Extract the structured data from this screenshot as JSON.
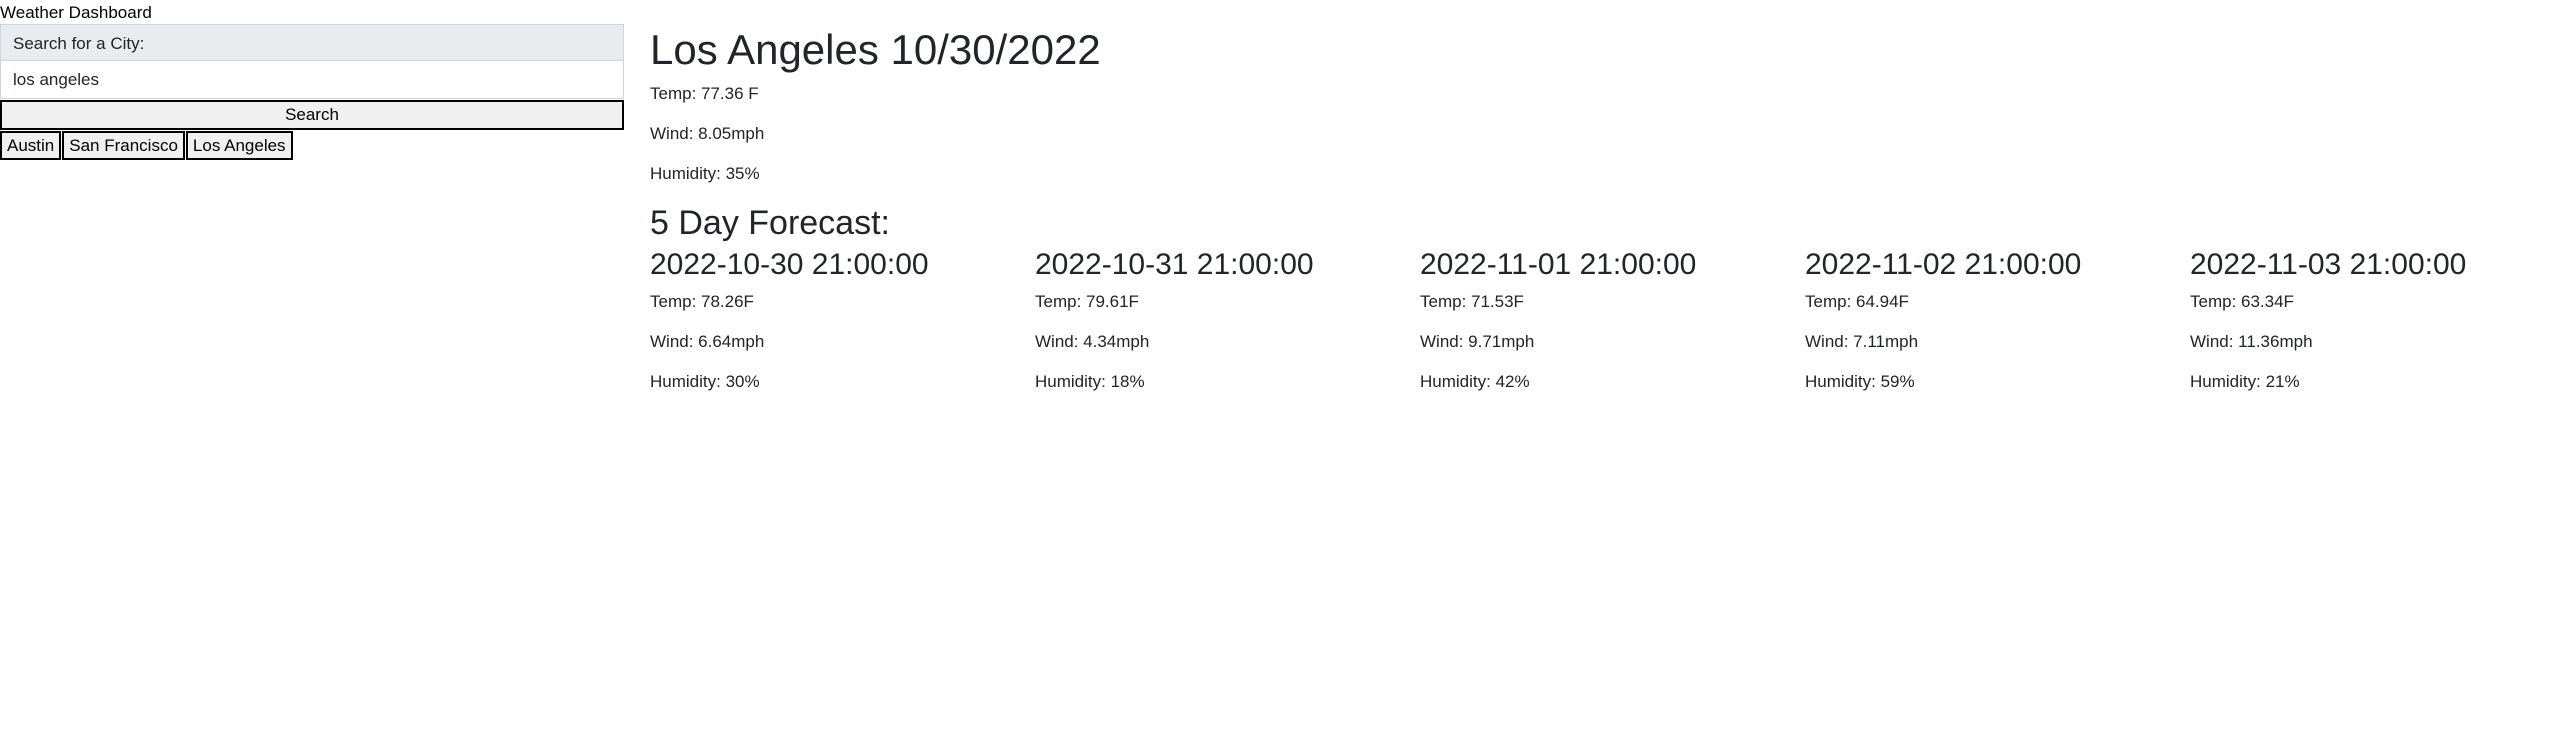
{
  "app": {
    "title": "Weather Dashboard"
  },
  "search": {
    "label": "Search for a City:",
    "value": "los angeles",
    "button_label": "Search"
  },
  "history": [
    "Austin",
    "San Francisco",
    "Los Angeles"
  ],
  "current": {
    "title": "Los Angeles 10/30/2022",
    "temp": "Temp: 77.36 F",
    "wind": "Wind: 8.05mph",
    "humidity": "Humidity: 35%"
  },
  "forecast": {
    "heading": "5 Day Forecast:",
    "days": [
      {
        "date": "2022-10-30 21:00:00",
        "temp": "Temp: 78.26F",
        "wind": "Wind: 6.64mph",
        "humidity": "Humidity: 30%"
      },
      {
        "date": "2022-10-31 21:00:00",
        "temp": "Temp: 79.61F",
        "wind": "Wind: 4.34mph",
        "humidity": "Humidity: 18%"
      },
      {
        "date": "2022-11-01 21:00:00",
        "temp": "Temp: 71.53F",
        "wind": "Wind: 9.71mph",
        "humidity": "Humidity: 42%"
      },
      {
        "date": "2022-11-02 21:00:00",
        "temp": "Temp: 64.94F",
        "wind": "Wind: 7.11mph",
        "humidity": "Humidity: 59%"
      },
      {
        "date": "2022-11-03 21:00:00",
        "temp": "Temp: 63.34F",
        "wind": "Wind: 11.36mph",
        "humidity": "Humidity: 21%"
      }
    ]
  }
}
